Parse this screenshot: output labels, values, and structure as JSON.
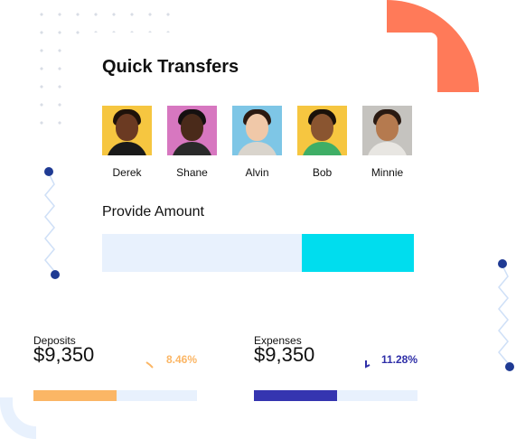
{
  "quick_transfers": {
    "title": "Quick Transfers",
    "contacts": [
      {
        "name": "Derek",
        "bg": "#f6c640",
        "skin": "#6b3a22",
        "hair": "#1e120a",
        "shirt": "#1a1a1a"
      },
      {
        "name": "Shane",
        "bg": "#d777c0",
        "skin": "#4a2a1a",
        "hair": "#151010",
        "shirt": "#2a2a2a"
      },
      {
        "name": "Alvin",
        "bg": "#7ec6e6",
        "skin": "#f0c8a8",
        "hair": "#2b1a12",
        "shirt": "#d9d4cc"
      },
      {
        "name": "Bob",
        "bg": "#f6c640",
        "skin": "#8a5530",
        "hair": "#1a120a",
        "shirt": "#3fae66"
      },
      {
        "name": "Minnie",
        "bg": "#c5c3bf",
        "skin": "#b57a4f",
        "hair": "#2a1a12",
        "shirt": "#e8e6e2"
      }
    ],
    "amount_label": "Provide Amount",
    "amount_slider_fraction": 0.36
  },
  "stats": [
    {
      "label": "Deposits",
      "value": "$9,350",
      "change": "8.46%",
      "direction": "up",
      "change_color": "#fbb665",
      "bar_color": "#fbb665",
      "bar_fraction": 0.51
    },
    {
      "label": "Expenses",
      "value": "$9,350",
      "change": "11.28%",
      "direction": "down",
      "change_color": "#2f2fa8",
      "bar_color": "#3535b0",
      "bar_fraction": 0.51
    }
  ],
  "colors": {
    "accent_orange": "#ff7a59",
    "accent_cyan": "#00ddee",
    "navy_dot": "#1f3a93",
    "light_blue": "#e8f1fd"
  }
}
